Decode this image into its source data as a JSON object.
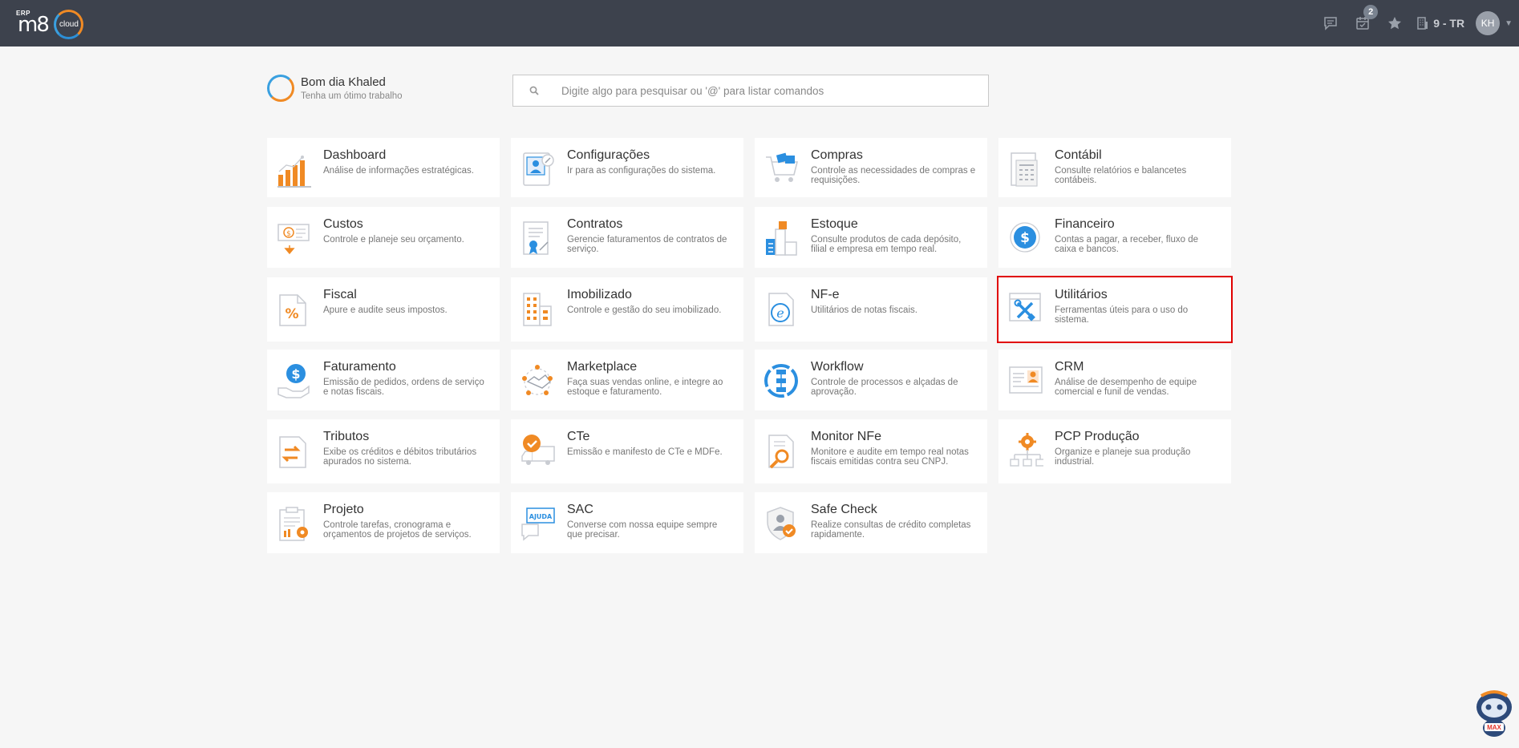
{
  "topbar": {
    "logo_erp": "ERP",
    "logo_m8": "m8",
    "logo_cloud": "cloud",
    "notifications_badge": "2",
    "company": "9 - TR",
    "avatar": "KH"
  },
  "greeting": {
    "title": "Bom dia Khaled",
    "subtitle": "Tenha um ótimo trabalho"
  },
  "search": {
    "placeholder": "Digite algo para pesquisar ou '@' para listar comandos"
  },
  "modules": [
    {
      "title": "Dashboard",
      "desc": "Análise de informações estratégicas.",
      "icon": "bar-chart-icon"
    },
    {
      "title": "Configurações",
      "desc": "Ir para as configurações do sistema.",
      "icon": "settings-profile-icon"
    },
    {
      "title": "Compras",
      "desc": "Controle as necessidades de compras e requisições.",
      "icon": "shopping-cart-icon"
    },
    {
      "title": "Contábil",
      "desc": "Consulte relatórios e balancetes contábeis.",
      "icon": "calculator-document-icon"
    },
    {
      "title": "Custos",
      "desc": "Controle e planeje seu orçamento.",
      "icon": "money-bill-icon"
    },
    {
      "title": "Contratos",
      "desc": "Gerencie faturamentos de contratos de serviço.",
      "icon": "contract-icon"
    },
    {
      "title": "Estoque",
      "desc": "Consulte produtos de cada depósito, filial e empresa em tempo real.",
      "icon": "warehouse-icon"
    },
    {
      "title": "Financeiro",
      "desc": "Contas a pagar, a receber, fluxo de caixa e bancos.",
      "icon": "dollar-coin-icon"
    },
    {
      "title": "Fiscal",
      "desc": "Apure e audite seus impostos.",
      "icon": "percent-document-icon"
    },
    {
      "title": "Imobilizado",
      "desc": "Controle e gestão do seu imobilizado.",
      "icon": "building-icon"
    },
    {
      "title": "NF-e",
      "desc": "Utilitários de notas fiscais.",
      "icon": "nfe-document-icon"
    },
    {
      "title": "Utilitários",
      "desc": "Ferramentas úteis para o uso do sistema.",
      "icon": "tools-icon"
    },
    {
      "title": "Faturamento",
      "desc": "Emissão de pedidos, ordens de serviço e notas fiscais.",
      "icon": "dollar-hand-icon"
    },
    {
      "title": "Marketplace",
      "desc": "Faça suas vendas online, e integre ao estoque e faturamento.",
      "icon": "handshake-icon"
    },
    {
      "title": "Workflow",
      "desc": "Controle de processos e alçadas de aprovação.",
      "icon": "workflow-icon"
    },
    {
      "title": "CRM",
      "desc": "Análise de desempenho de equipe comercial e funil de vendas.",
      "icon": "contact-card-icon"
    },
    {
      "title": "Tributos",
      "desc": "Exibe os créditos e débitos tributários apurados no sistema.",
      "icon": "transfer-document-icon"
    },
    {
      "title": "CTe",
      "desc": "Emissão e manifesto de CTe e MDFe.",
      "icon": "truck-check-icon"
    },
    {
      "title": "Monitor NFe",
      "desc": "Monitore e audite em tempo real notas fiscais emitidas contra seu CNPJ.",
      "icon": "magnifier-document-icon"
    },
    {
      "title": "PCP Produção",
      "desc": "Organize e planeje sua produção industrial.",
      "icon": "production-gear-icon"
    },
    {
      "title": "Projeto",
      "desc": "Controle tarefas, cronograma e orçamentos de projetos de serviços.",
      "icon": "clipboard-gear-icon"
    },
    {
      "title": "SAC",
      "desc": "Converse com nossa equipe sempre que precisar.",
      "icon": "help-chat-icon"
    },
    {
      "title": "Safe Check",
      "desc": "Realize consultas de crédito completas rapidamente.",
      "icon": "shield-check-icon"
    }
  ],
  "help_icon_label": "MAX"
}
